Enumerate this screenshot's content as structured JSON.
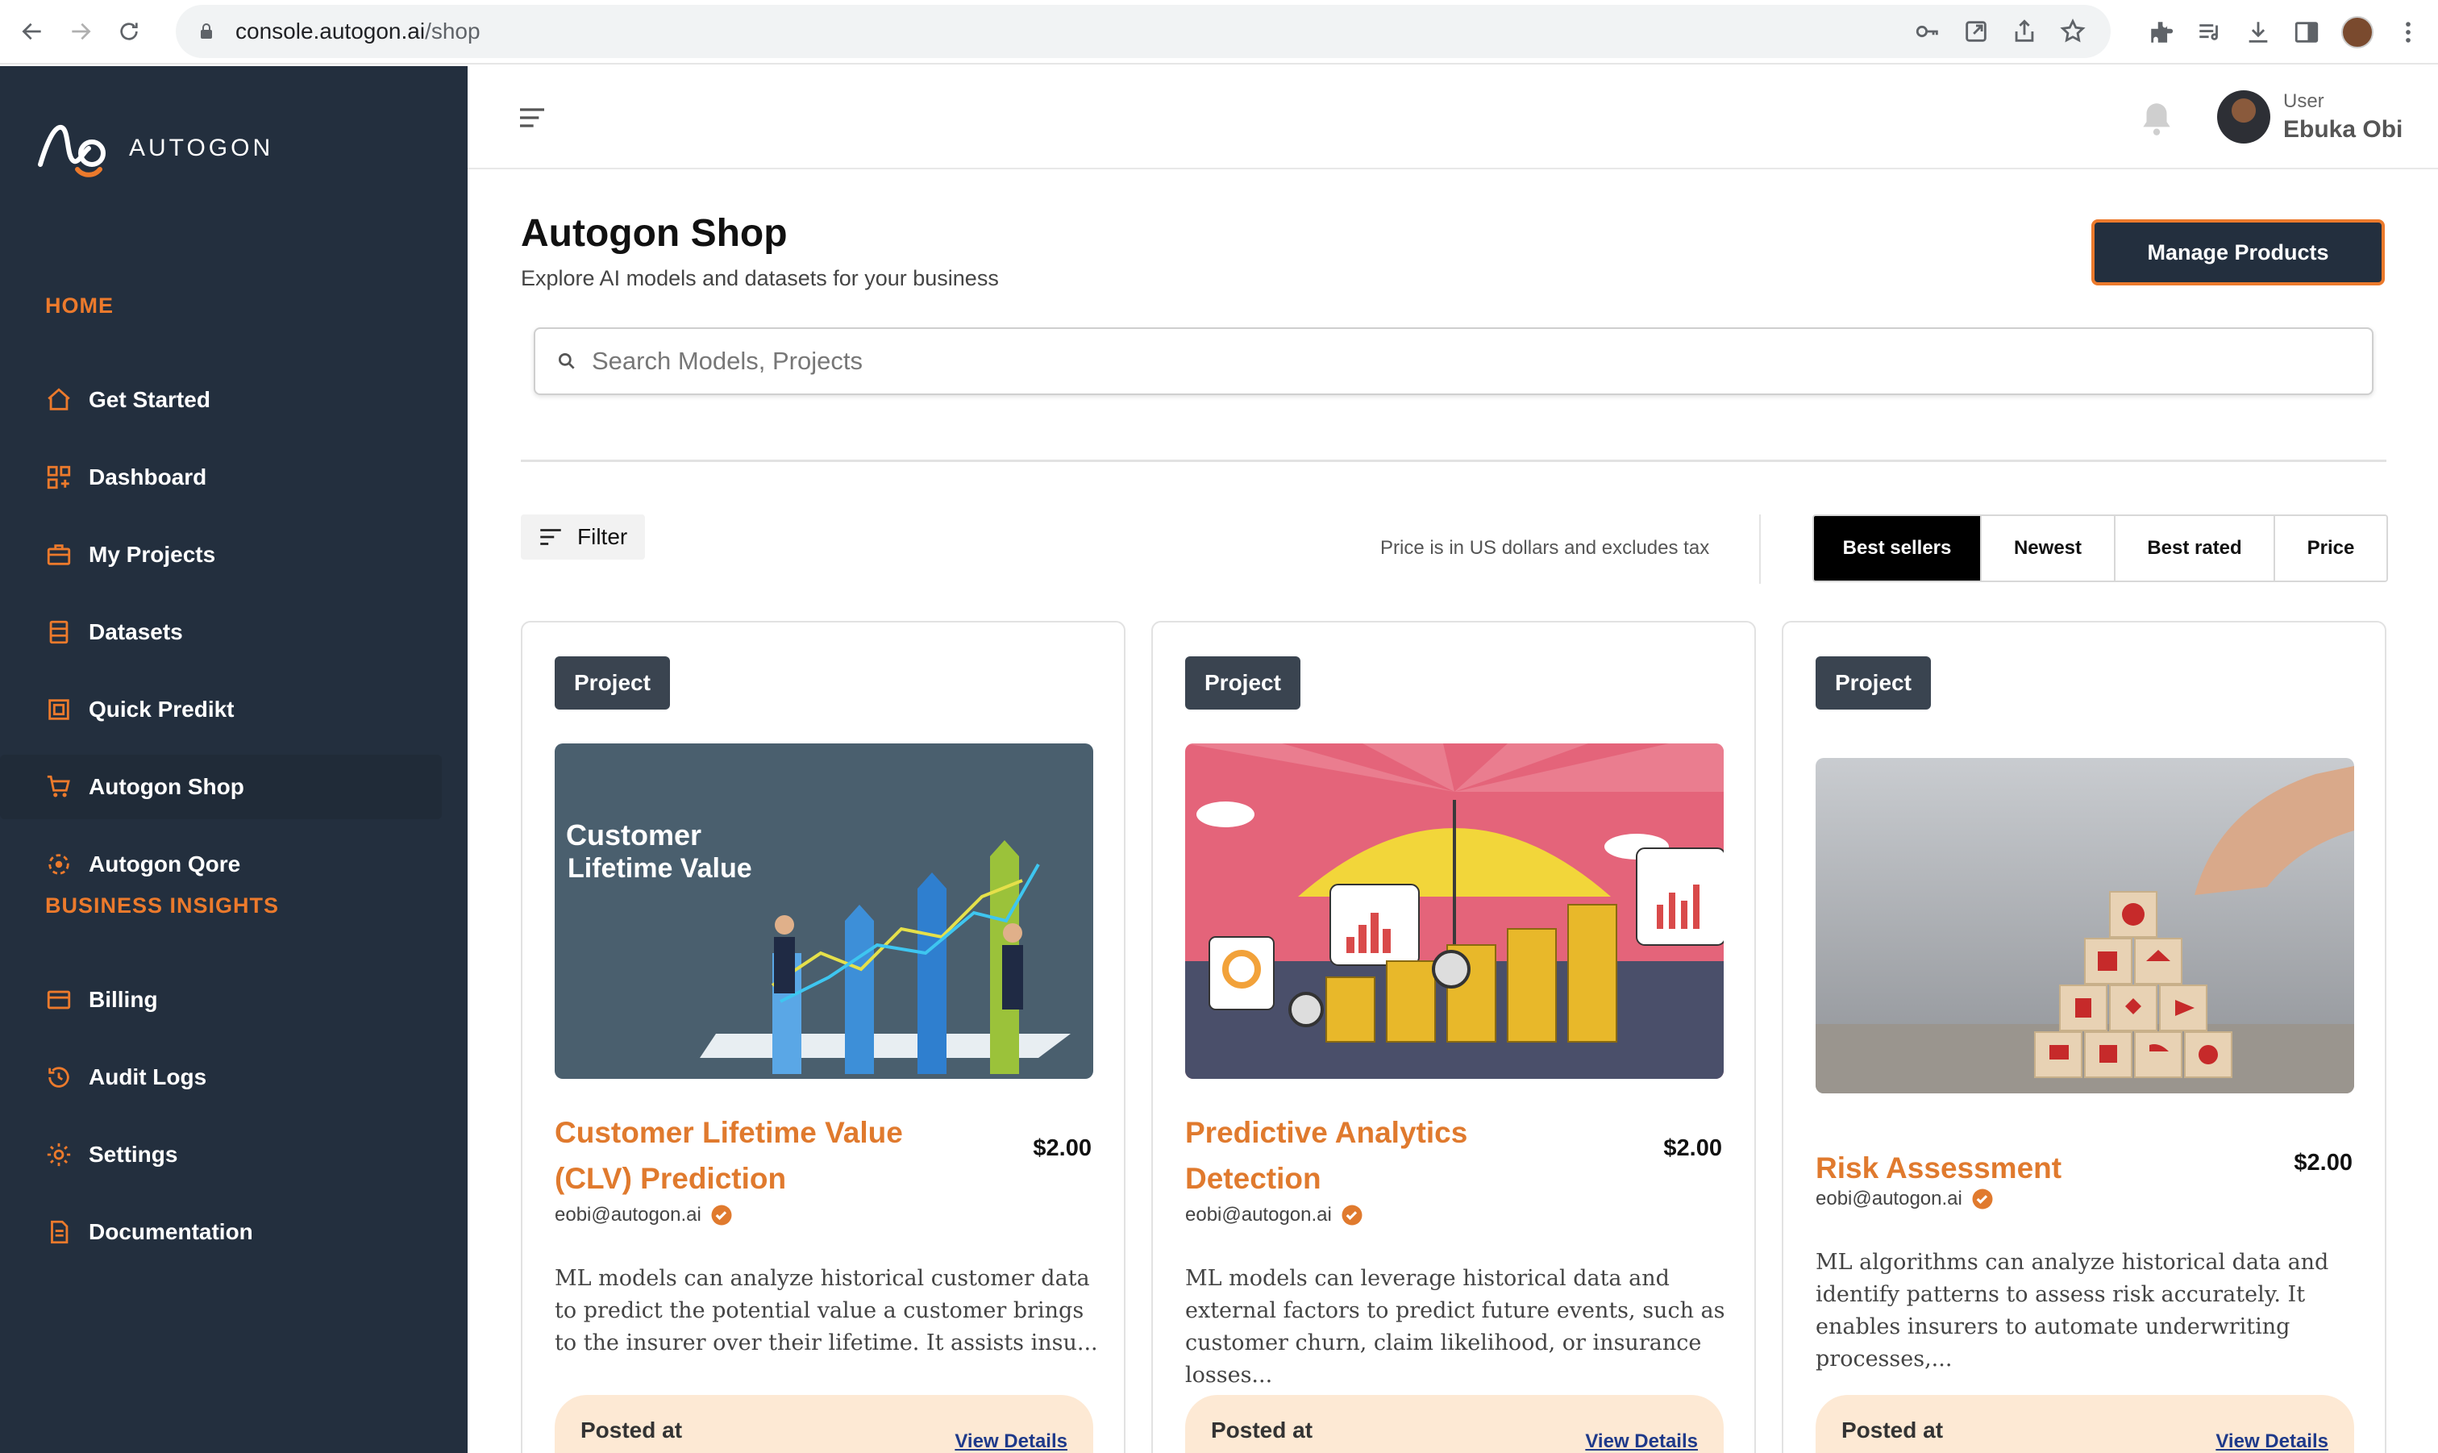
{
  "browser": {
    "url_host": "console.autogon.ai",
    "url_path": "/shop"
  },
  "sidebar": {
    "logo_text": "AUTOGON",
    "sections": [
      {
        "title": "HOME"
      },
      {
        "title": "BUSINESS INSIGHTS"
      }
    ],
    "items": [
      {
        "label": "Get Started",
        "icon": "home-icon"
      },
      {
        "label": "Dashboard",
        "icon": "grid-icon"
      },
      {
        "label": "My Projects",
        "icon": "briefcase-icon"
      },
      {
        "label": "Datasets",
        "icon": "database-icon"
      },
      {
        "label": "Quick Predikt",
        "icon": "chip-icon"
      },
      {
        "label": "Autogon Shop",
        "icon": "cart-icon",
        "active": true
      },
      {
        "label": "Autogon Qore",
        "icon": "qore-icon"
      },
      {
        "label": "Billing",
        "icon": "card-icon"
      },
      {
        "label": "Audit Logs",
        "icon": "history-icon"
      },
      {
        "label": "Settings",
        "icon": "gear-icon"
      },
      {
        "label": "Documentation",
        "icon": "document-icon"
      }
    ]
  },
  "header": {
    "user_role": "User",
    "user_name": "Ebuka Obi"
  },
  "main": {
    "title": "Autogon Shop",
    "subtitle": "Explore AI models and datasets for your business",
    "manage_button": "Manage Products",
    "search_placeholder": "Search Models, Projects",
    "filter_label": "Filter",
    "price_note": "Price is in US dollars and excludes tax",
    "sort_options": [
      {
        "label": "Best sellers",
        "active": true
      },
      {
        "label": "Newest"
      },
      {
        "label": "Best rated"
      },
      {
        "label": "Price"
      }
    ]
  },
  "cards": [
    {
      "tag": "Project",
      "title": "Customer Lifetime Value (CLV) Prediction",
      "price": "$2.00",
      "author": "eobi@autogon.ai",
      "description": "ML models can analyze historical customer data to predict the potential value a customer brings to the insurer over their lifetime. It assists insu...",
      "posted_label": "Posted at",
      "view_label": "View Details",
      "image_text_1": "Customer",
      "image_text_2": "Lifetime Value"
    },
    {
      "tag": "Project",
      "title": "Predictive Analytics Detection",
      "price": "$2.00",
      "author": "eobi@autogon.ai",
      "description": "ML models can leverage historical data and external factors to predict future events, such as customer churn, claim likelihood, or insurance losses...",
      "posted_label": "Posted at",
      "view_label": "View Details"
    },
    {
      "tag": "Project",
      "title": "Risk Assessment",
      "price": "$2.00",
      "author": "eobi@autogon.ai",
      "description": "ML algorithms can analyze historical data and identify patterns to assess risk accurately. It enables insurers to automate underwriting processes,...",
      "posted_label": "Posted at",
      "view_label": "View Details"
    }
  ],
  "colors": {
    "sidebar_bg": "#232f3e",
    "accent": "#ec7a2c",
    "card_title": "#e07a2e",
    "posted_bg": "#fde9d4"
  }
}
